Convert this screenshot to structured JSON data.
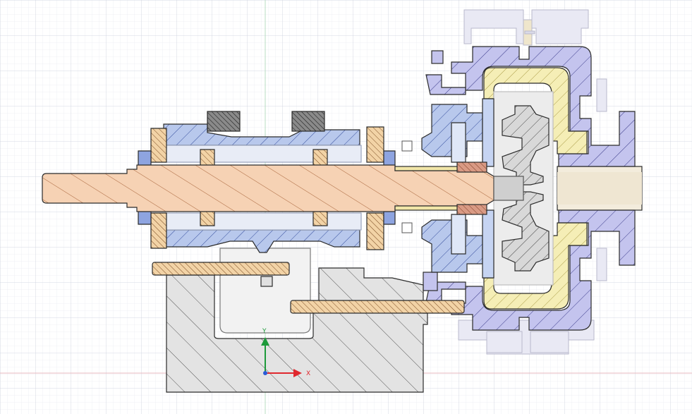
{
  "canvas": {
    "background": "#ffffff",
    "grid_minor_color": "#e4e6ee",
    "grid_major_color": "#cdd1de",
    "origin_line_x_color": "#e9b9c0",
    "origin_line_y_color": "#b8dcc3"
  },
  "axes_indicator": {
    "x_label": "X",
    "y_label": "Y",
    "x_color": "#e0282e",
    "y_color": "#1d9a3a",
    "origin_color": "#2a5bd7"
  },
  "section_colors": {
    "shaft": "#f6d2b4",
    "shaft_hatch": "#a8643a",
    "bearing_housing": "#b8c8ec",
    "housing_hatch": "#334c9c",
    "casing": "#c4c4ee",
    "liner": "#f5eeb6",
    "liner_hatch": "#a99b46",
    "impeller": "#d8d8d8",
    "base": "#e3e3e3",
    "base_hatch": "#555555",
    "ghost": "#e9e9f4",
    "outline": "#2b2b2b"
  }
}
